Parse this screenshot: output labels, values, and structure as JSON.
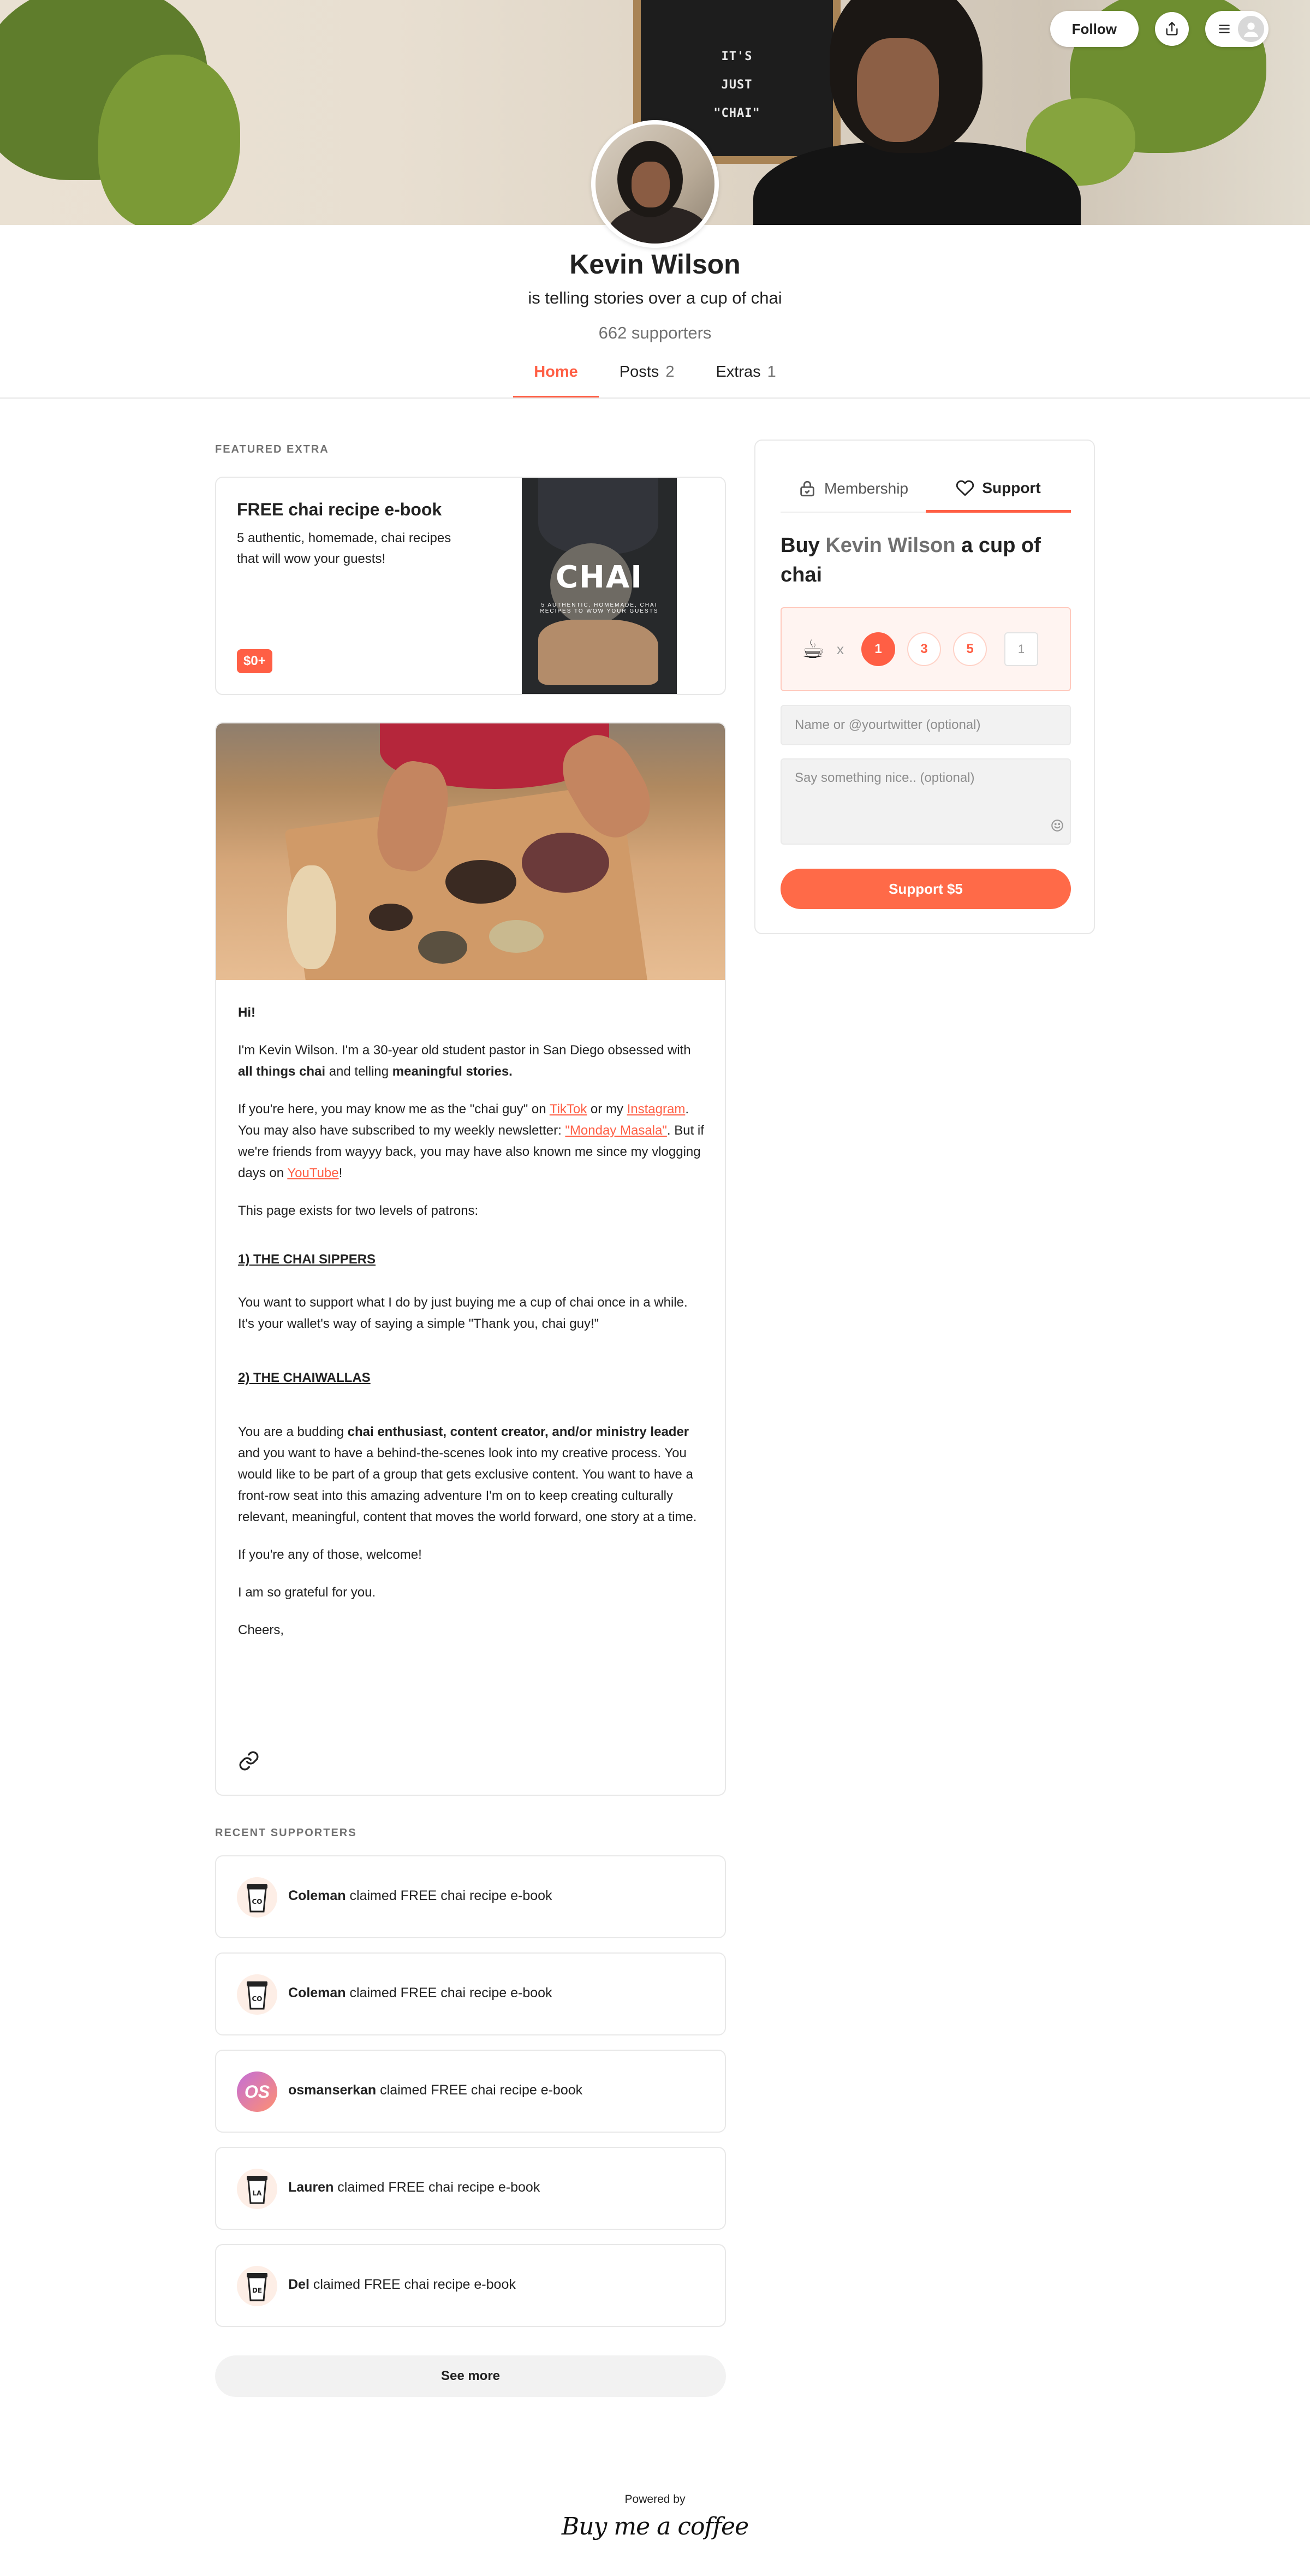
{
  "cover": {
    "board_lines": [
      "IT'S",
      "JUST",
      "\"CHAI\""
    ]
  },
  "header_actions": {
    "follow_label": "Follow"
  },
  "profile": {
    "name": "Kevin Wilson",
    "tagline": "is telling stories over a cup of chai",
    "supporters": "662 supporters"
  },
  "tabs": [
    {
      "label": "Home",
      "count": ""
    },
    {
      "label": "Posts",
      "count": "2"
    },
    {
      "label": "Extras",
      "count": "1"
    }
  ],
  "featured": {
    "section_label": "FEATURED EXTRA",
    "title": "FREE chai recipe e-book",
    "description": "5 authentic, homemade, chai recipes that will wow your guests!",
    "price": "$0+",
    "cover_title": "CHAI",
    "cover_subtitle": "5 AUTHENTIC, HOMEMADE, CHAI RECIPES TO WOW YOUR GUESTS"
  },
  "about": {
    "greeting": "Hi!",
    "p1_a": "I'm Kevin Wilson. I'm a 30-year old student pastor in San Diego obsessed with ",
    "p1_b": "all things chai",
    "p1_c": " and telling ",
    "p1_d": "meaningful stories.",
    "p2_a": "If you're here, you may know me as the \"chai guy\" on ",
    "p2_tiktok": "TikTok",
    "p2_b": " or my ",
    "p2_instagram": "Instagram",
    "p2_c": ". You may also have subscribed to my weekly newsletter: ",
    "p2_newsletter": "\"Monday Masala\"",
    "p2_d": ". But if we're friends from wayyy back, you may have also known me since my vlogging days on ",
    "p2_youtube": "YouTube",
    "p2_e": "!",
    "p3": "This page exists for two levels of patrons:",
    "head1": "1) THE CHAI SIPPERS",
    "p4": "You want to support what I do by just buying me a cup of chai once in a while. It's your wallet's way of saying a simple \"Thank you, chai guy!\"",
    "head2": "2) THE CHAIWALLAS",
    "p5_a": "You are a budding ",
    "p5_b": "chai enthusiast, content creator, and/or ministry leader",
    "p5_c": " and you want to have a behind-the-scenes look into my creative process. You would like to be part of a group that gets exclusive content. You want to have a front-row seat into this amazing adventure I'm on to keep creating culturally relevant, meaningful, content that moves the world forward, one story at a time.",
    "p6": "If you're any of those, welcome!",
    "p7": "I am so grateful for you.",
    "p8": "Cheers,"
  },
  "recent": {
    "section_label": "RECENT SUPPORTERS",
    "action_text": " claimed FREE chai recipe e-book",
    "items": [
      {
        "name": "Coleman",
        "avatar": "CO",
        "type": "cup"
      },
      {
        "name": "Coleman",
        "avatar": "CO",
        "type": "cup"
      },
      {
        "name": "osmanserkan",
        "avatar": "OS",
        "type": "initials"
      },
      {
        "name": "Lauren",
        "avatar": "LA",
        "type": "cup"
      },
      {
        "name": "Del",
        "avatar": "DE",
        "type": "cup"
      }
    ],
    "see_more": "See more"
  },
  "footer": {
    "powered_by": "Powered by",
    "logo_text": "Buy me a coffee"
  },
  "widget": {
    "tab_membership": "Membership",
    "tab_support": "Support",
    "title_a": "Buy ",
    "title_creator": "Kevin Wilson",
    "title_b": " a cup of chai",
    "cup_emoji": "☕",
    "times": "x",
    "quantities": [
      "1",
      "3",
      "5"
    ],
    "custom_quantity": "1",
    "name_placeholder": "Name or @yourtwitter (optional)",
    "message_placeholder": "Say something nice.. (optional)",
    "support_button": "Support $5"
  },
  "colors": {
    "accent": "#ff5f45",
    "accent_light": "#fff4f1",
    "muted": "#717171"
  }
}
